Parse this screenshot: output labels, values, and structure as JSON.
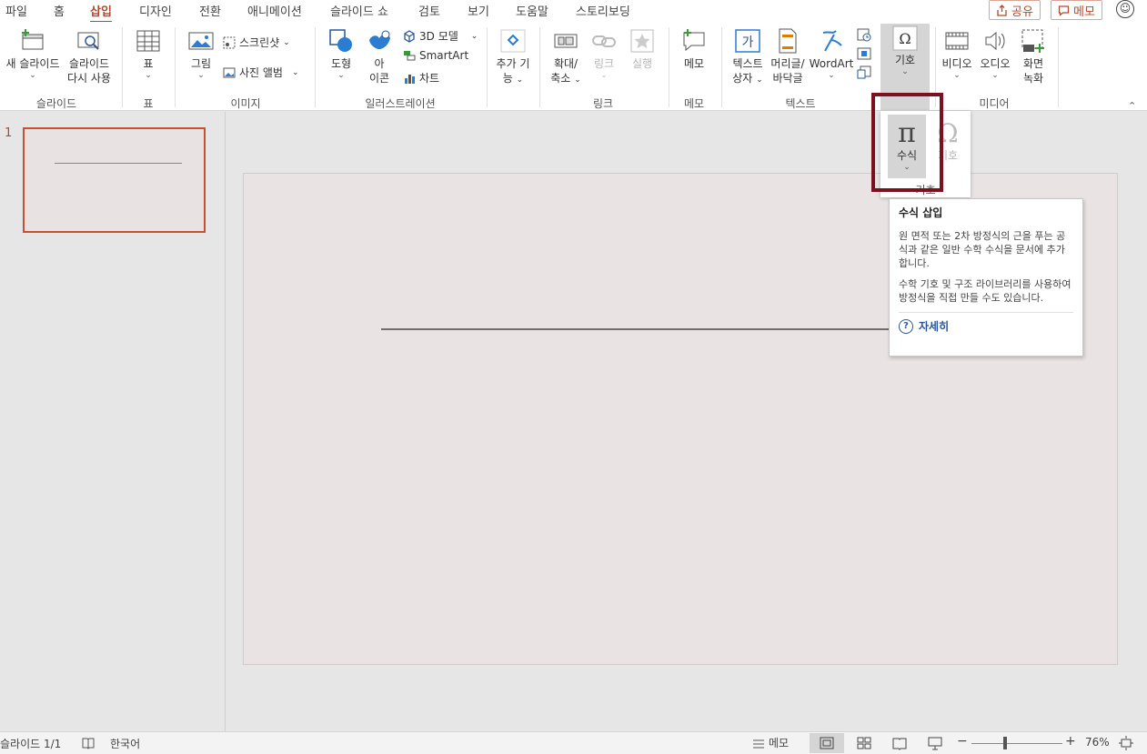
{
  "menu": {
    "tabs": [
      "파일",
      "홈",
      "삽입",
      "디자인",
      "전환",
      "애니메이션",
      "슬라이드 쇼",
      "검토",
      "보기",
      "도움말",
      "스토리보딩"
    ],
    "share_label": "공유",
    "comment_label": "메모"
  },
  "ribbon": {
    "groups": {
      "slides": "슬라이드",
      "table": "표",
      "images": "이미지",
      "illustrations": "일러스트레이션",
      "links": "링크",
      "comments": "메모",
      "text": "텍스트",
      "media": "미디어"
    },
    "new_slide": "새 슬라이드",
    "reuse_slides_1": "슬라이드",
    "reuse_slides_2": "다시 사용",
    "table": "표",
    "picture": "그림",
    "screenshot": "스크린샷",
    "photo_album": "사진 앨범",
    "shapes": "도형",
    "icons_1": "아",
    "icons_2": "이콘",
    "model_3d": "3D 모델",
    "smartart": "SmartArt",
    "chart": "차트",
    "addins_1": "추가 기",
    "addins_2": "능",
    "zoom_1": "확대/",
    "zoom_2": "축소",
    "link": "링크",
    "action": "실행",
    "comment": "메모",
    "textbox_1": "텍스트",
    "textbox_2": "상자",
    "header_1": "머리글/",
    "header_2": "바닥글",
    "wordart": "WordArt",
    "symbols": "기호",
    "video": "비디오",
    "audio": "오디오",
    "screen_rec_1": "화면",
    "screen_rec_2": "녹화"
  },
  "thumbnail": {
    "number": "1"
  },
  "dropdown": {
    "equation": "수식",
    "symbol": "기호",
    "group_label": "기호"
  },
  "tooltip": {
    "title": "수식 삽입",
    "desc1": "원 면적 또는 2차 방정식의 근을 푸는 공식과 같은 일반 수학 수식을 문서에 추가합니다.",
    "desc2": "수학 기호 및 구조 라이브러리를 사용하여 방정식을 직접 만들 수도 있습니다.",
    "more": "자세히"
  },
  "status": {
    "slide_count": "슬라이드 1/1",
    "language": "한국어",
    "notes": "메모",
    "zoom": "76%"
  }
}
